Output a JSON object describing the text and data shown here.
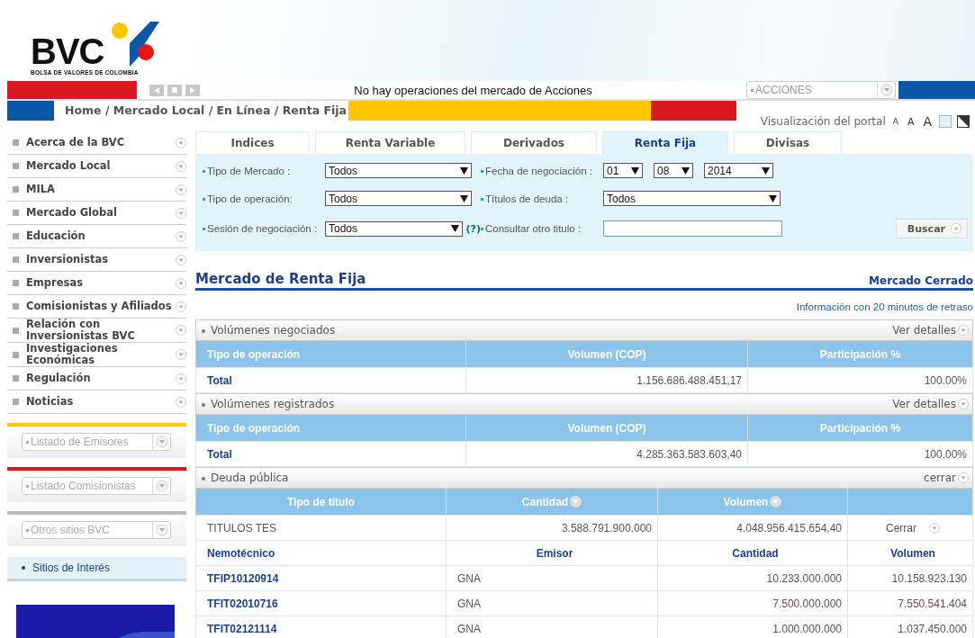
{
  "logo": {
    "name": "BVC",
    "tagline": "BOLSA DE VALORES DE COLOMBIA"
  },
  "ticker": {
    "message": "No hay operaciones del mercado de Acciones",
    "market_select": "ACCIONES"
  },
  "breadcrumb": "Home / Mercado Local / En Línea / Renta Fija",
  "portal": {
    "label": "Visualización del portal",
    "font_sizes": [
      "A",
      "A",
      "A"
    ]
  },
  "sidebar": {
    "items": [
      {
        "label": "Acerca de la BVC"
      },
      {
        "label": "Mercado Local"
      },
      {
        "label": "MILA"
      },
      {
        "label": "Mercado Global"
      },
      {
        "label": "Educación"
      },
      {
        "label": "Inversionistas"
      },
      {
        "label": "Empresas"
      },
      {
        "label": "Comisionistas y Afiliados"
      },
      {
        "label": "Relación con Inversionistas BVC"
      },
      {
        "label": "Investigaciones Económicas"
      },
      {
        "label": "Regulación"
      },
      {
        "label": "Noticias"
      }
    ],
    "selects": [
      {
        "label": "Listado de Emisores",
        "color": "#ffc600"
      },
      {
        "label": "Listado Comisionistas",
        "color": "#e8141c"
      },
      {
        "label": "Otros sitios BVC",
        "color": "#bbbbbb"
      }
    ],
    "link": "Sitios de Interés"
  },
  "tabs": [
    {
      "label": "Indices",
      "selected": false
    },
    {
      "label": "Renta Variable",
      "selected": false
    },
    {
      "label": "Derivados",
      "selected": false
    },
    {
      "label": "Renta Fija",
      "selected": true
    },
    {
      "label": "Divisas",
      "selected": false
    }
  ],
  "filters": {
    "tipo_mercado": {
      "label": "Tipo de Mercado :",
      "value": "Todos"
    },
    "tipo_operacion": {
      "label": "Tipo de operación:",
      "value": "Todos"
    },
    "sesion": {
      "label": "Sesión de negociación :",
      "value": "Todos",
      "help": "(?)"
    },
    "fecha": {
      "label": "Fecha de negociación :",
      "day": "01",
      "month": "08",
      "year": "2014"
    },
    "titulos": {
      "label": "Títulos de deuda :",
      "value": "Todos"
    },
    "otro_titulo": {
      "label": "Consultar otro titulo :"
    },
    "search_button": "Buscar"
  },
  "section": {
    "title": "Mercado de Renta Fija",
    "status": "Mercado Cerrado",
    "note": "Información con 20 minutos de retraso"
  },
  "volume_panels": [
    {
      "title": "Volúmenes negociados",
      "action": "Ver detalles",
      "columns": [
        "Tipo de operación",
        "Volumen (COP)",
        "Participación %"
      ],
      "rows": [
        [
          "Total",
          "1.156.686.488.451,17",
          "100.00%"
        ]
      ]
    },
    {
      "title": "Volúmenes registrados",
      "action": "Ver detalles",
      "columns": [
        "Tipo de operación",
        "Volumen (COP)",
        "Participación %"
      ],
      "rows": [
        [
          "Total",
          "4.285.363.583.603,40",
          "100.00%"
        ]
      ]
    }
  ],
  "debt_panel": {
    "title": "Deuda pública",
    "action": "cerrar",
    "columns": [
      "Tipo de título",
      "Cantidad",
      "Volumen"
    ],
    "group": {
      "name": "TITULOS TES",
      "cantidad": "3.588.791.900.000",
      "volumen": "4.048.956.415.654,40",
      "action": "Cerrar"
    },
    "sub_columns": [
      "Nemotécnico",
      "Emisor",
      "Cantidad",
      "Volumen"
    ],
    "rows": [
      [
        "TFIP10120914",
        "GNA",
        "10.233.000.000",
        "10.158.923.130"
      ],
      [
        "TFIT02010716",
        "GNA",
        "7.500.000.000",
        "7.550.541.404"
      ],
      [
        "TFIT02121114",
        "GNA",
        "1.000.000.000",
        "1.037.450.000"
      ]
    ]
  }
}
